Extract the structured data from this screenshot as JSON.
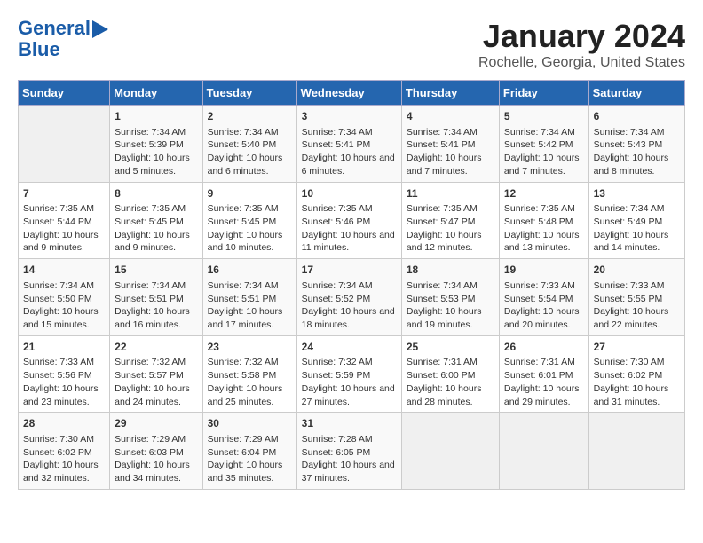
{
  "logo": {
    "line1": "General",
    "line2": "Blue"
  },
  "title": "January 2024",
  "subtitle": "Rochelle, Georgia, United States",
  "days_of_week": [
    "Sunday",
    "Monday",
    "Tuesday",
    "Wednesday",
    "Thursday",
    "Friday",
    "Saturday"
  ],
  "weeks": [
    [
      {
        "num": "",
        "sunrise": "",
        "sunset": "",
        "daylight": ""
      },
      {
        "num": "1",
        "sunrise": "Sunrise: 7:34 AM",
        "sunset": "Sunset: 5:39 PM",
        "daylight": "Daylight: 10 hours and 5 minutes."
      },
      {
        "num": "2",
        "sunrise": "Sunrise: 7:34 AM",
        "sunset": "Sunset: 5:40 PM",
        "daylight": "Daylight: 10 hours and 6 minutes."
      },
      {
        "num": "3",
        "sunrise": "Sunrise: 7:34 AM",
        "sunset": "Sunset: 5:41 PM",
        "daylight": "Daylight: 10 hours and 6 minutes."
      },
      {
        "num": "4",
        "sunrise": "Sunrise: 7:34 AM",
        "sunset": "Sunset: 5:41 PM",
        "daylight": "Daylight: 10 hours and 7 minutes."
      },
      {
        "num": "5",
        "sunrise": "Sunrise: 7:34 AM",
        "sunset": "Sunset: 5:42 PM",
        "daylight": "Daylight: 10 hours and 7 minutes."
      },
      {
        "num": "6",
        "sunrise": "Sunrise: 7:34 AM",
        "sunset": "Sunset: 5:43 PM",
        "daylight": "Daylight: 10 hours and 8 minutes."
      }
    ],
    [
      {
        "num": "7",
        "sunrise": "Sunrise: 7:35 AM",
        "sunset": "Sunset: 5:44 PM",
        "daylight": "Daylight: 10 hours and 9 minutes."
      },
      {
        "num": "8",
        "sunrise": "Sunrise: 7:35 AM",
        "sunset": "Sunset: 5:45 PM",
        "daylight": "Daylight: 10 hours and 9 minutes."
      },
      {
        "num": "9",
        "sunrise": "Sunrise: 7:35 AM",
        "sunset": "Sunset: 5:45 PM",
        "daylight": "Daylight: 10 hours and 10 minutes."
      },
      {
        "num": "10",
        "sunrise": "Sunrise: 7:35 AM",
        "sunset": "Sunset: 5:46 PM",
        "daylight": "Daylight: 10 hours and 11 minutes."
      },
      {
        "num": "11",
        "sunrise": "Sunrise: 7:35 AM",
        "sunset": "Sunset: 5:47 PM",
        "daylight": "Daylight: 10 hours and 12 minutes."
      },
      {
        "num": "12",
        "sunrise": "Sunrise: 7:35 AM",
        "sunset": "Sunset: 5:48 PM",
        "daylight": "Daylight: 10 hours and 13 minutes."
      },
      {
        "num": "13",
        "sunrise": "Sunrise: 7:34 AM",
        "sunset": "Sunset: 5:49 PM",
        "daylight": "Daylight: 10 hours and 14 minutes."
      }
    ],
    [
      {
        "num": "14",
        "sunrise": "Sunrise: 7:34 AM",
        "sunset": "Sunset: 5:50 PM",
        "daylight": "Daylight: 10 hours and 15 minutes."
      },
      {
        "num": "15",
        "sunrise": "Sunrise: 7:34 AM",
        "sunset": "Sunset: 5:51 PM",
        "daylight": "Daylight: 10 hours and 16 minutes."
      },
      {
        "num": "16",
        "sunrise": "Sunrise: 7:34 AM",
        "sunset": "Sunset: 5:51 PM",
        "daylight": "Daylight: 10 hours and 17 minutes."
      },
      {
        "num": "17",
        "sunrise": "Sunrise: 7:34 AM",
        "sunset": "Sunset: 5:52 PM",
        "daylight": "Daylight: 10 hours and 18 minutes."
      },
      {
        "num": "18",
        "sunrise": "Sunrise: 7:34 AM",
        "sunset": "Sunset: 5:53 PM",
        "daylight": "Daylight: 10 hours and 19 minutes."
      },
      {
        "num": "19",
        "sunrise": "Sunrise: 7:33 AM",
        "sunset": "Sunset: 5:54 PM",
        "daylight": "Daylight: 10 hours and 20 minutes."
      },
      {
        "num": "20",
        "sunrise": "Sunrise: 7:33 AM",
        "sunset": "Sunset: 5:55 PM",
        "daylight": "Daylight: 10 hours and 22 minutes."
      }
    ],
    [
      {
        "num": "21",
        "sunrise": "Sunrise: 7:33 AM",
        "sunset": "Sunset: 5:56 PM",
        "daylight": "Daylight: 10 hours and 23 minutes."
      },
      {
        "num": "22",
        "sunrise": "Sunrise: 7:32 AM",
        "sunset": "Sunset: 5:57 PM",
        "daylight": "Daylight: 10 hours and 24 minutes."
      },
      {
        "num": "23",
        "sunrise": "Sunrise: 7:32 AM",
        "sunset": "Sunset: 5:58 PM",
        "daylight": "Daylight: 10 hours and 25 minutes."
      },
      {
        "num": "24",
        "sunrise": "Sunrise: 7:32 AM",
        "sunset": "Sunset: 5:59 PM",
        "daylight": "Daylight: 10 hours and 27 minutes."
      },
      {
        "num": "25",
        "sunrise": "Sunrise: 7:31 AM",
        "sunset": "Sunset: 6:00 PM",
        "daylight": "Daylight: 10 hours and 28 minutes."
      },
      {
        "num": "26",
        "sunrise": "Sunrise: 7:31 AM",
        "sunset": "Sunset: 6:01 PM",
        "daylight": "Daylight: 10 hours and 29 minutes."
      },
      {
        "num": "27",
        "sunrise": "Sunrise: 7:30 AM",
        "sunset": "Sunset: 6:02 PM",
        "daylight": "Daylight: 10 hours and 31 minutes."
      }
    ],
    [
      {
        "num": "28",
        "sunrise": "Sunrise: 7:30 AM",
        "sunset": "Sunset: 6:02 PM",
        "daylight": "Daylight: 10 hours and 32 minutes."
      },
      {
        "num": "29",
        "sunrise": "Sunrise: 7:29 AM",
        "sunset": "Sunset: 6:03 PM",
        "daylight": "Daylight: 10 hours and 34 minutes."
      },
      {
        "num": "30",
        "sunrise": "Sunrise: 7:29 AM",
        "sunset": "Sunset: 6:04 PM",
        "daylight": "Daylight: 10 hours and 35 minutes."
      },
      {
        "num": "31",
        "sunrise": "Sunrise: 7:28 AM",
        "sunset": "Sunset: 6:05 PM",
        "daylight": "Daylight: 10 hours and 37 minutes."
      },
      {
        "num": "",
        "sunrise": "",
        "sunset": "",
        "daylight": ""
      },
      {
        "num": "",
        "sunrise": "",
        "sunset": "",
        "daylight": ""
      },
      {
        "num": "",
        "sunrise": "",
        "sunset": "",
        "daylight": ""
      }
    ]
  ]
}
